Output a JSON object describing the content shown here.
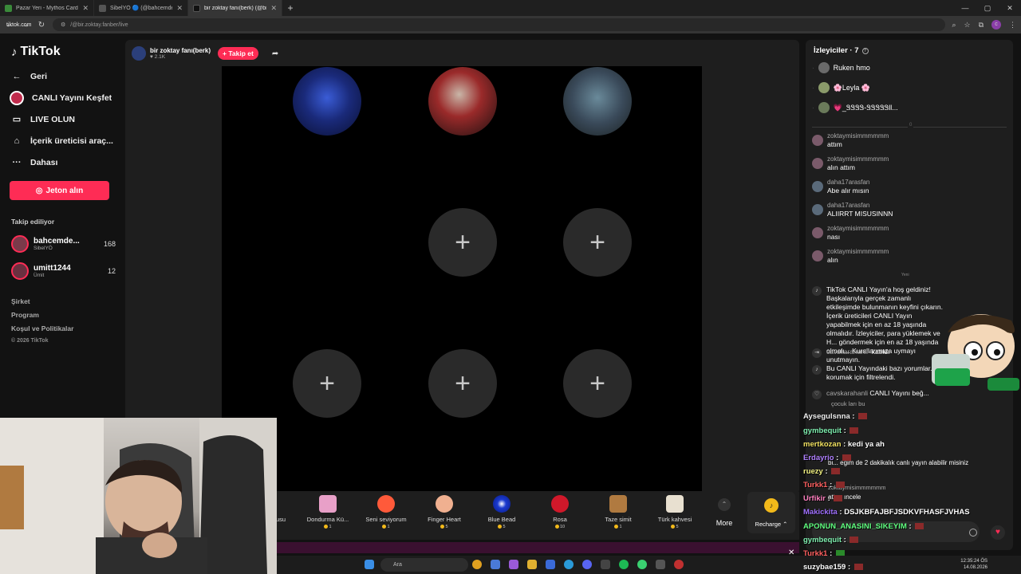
{
  "browser": {
    "tabs": [
      {
        "title": "Pazar Yeri - Mythos Cards",
        "color": "#3a8a3a",
        "active": false
      },
      {
        "title": "SibelYÖ 🔵 (@bahcemden...",
        "color": "#444444",
        "active": false
      },
      {
        "title": "bir zoktay fanı(berk) (@bir...",
        "color": "#444444",
        "active": true
      }
    ],
    "url_host": "tiktok.com",
    "url_path": "/@bir.zoktay.fanber/live"
  },
  "sidebar": {
    "logo": "TikTok",
    "items": [
      {
        "label": "Geri",
        "icon": "back-arrow-icon"
      },
      {
        "label": "CANLI Yayını Keşfet",
        "icon": "live-avatar-icon"
      },
      {
        "label": "LIVE OLUN",
        "icon": "camera-icon"
      },
      {
        "label": "İçerik üreticisi araç...",
        "icon": "home-icon"
      },
      {
        "label": "Dahası",
        "icon": "more-icon"
      }
    ],
    "jeton_button": "Jeton alın",
    "following_header": "Takip ediliyor",
    "following": [
      {
        "name": "bahcemde...",
        "sub": "SibelYÖ",
        "count": "168"
      },
      {
        "name": "umitt1244",
        "sub": "Ümit",
        "count": "12"
      }
    ],
    "footer": [
      "Şirket",
      "Program",
      "Koşul ve Politikalar"
    ],
    "copyright": "© 2026 TikTok"
  },
  "host": {
    "name": "bir zoktay fanı(berk)",
    "likes": "2.1K",
    "follow_button": "+ Takip et"
  },
  "gifts": [
    {
      "name": "usu",
      "price": ""
    },
    {
      "name": "Dondurma Kü...",
      "price": "1"
    },
    {
      "name": "Seni seviyorum",
      "price": "1"
    },
    {
      "name": "Finger Heart",
      "price": "5"
    },
    {
      "name": "Blue Bead",
      "price": "5"
    },
    {
      "name": "Rosa",
      "price": "10"
    },
    {
      "name": "Taze simit",
      "price": "1"
    },
    {
      "name": "Türk kahvesi",
      "price": "5"
    }
  ],
  "gift_more": "More",
  "recharge": "Recharge",
  "viewers": {
    "header": "İzleyiciler · 7",
    "list": [
      "Ruken hmo",
      "🌸Leyla 🌸",
      "💗_ᏕᏕᏕᏕ-ᏕᏕᏕᏕᏕll..."
    ],
    "divider_count": "0"
  },
  "chat": [
    {
      "user": "zoktaymisimmmmmm",
      "text": "attım"
    },
    {
      "user": "zoktaymisimmmmmm",
      "text": "alın attım"
    },
    {
      "user": "daha17arasfan",
      "text": "Abe alır mısın"
    },
    {
      "user": "daha17arasfan",
      "text": "ALIIRRT MISUSINNN"
    },
    {
      "user": "zoktaymisimmmmmm",
      "text": "nası"
    },
    {
      "user": "zoktaymisimmmmmm",
      "text": "alın"
    }
  ],
  "chat_new_label": "Yeni",
  "system": [
    {
      "text": "TikTok CANLI Yayın'a hoş geldiniz! Başkalarıyla gerçek zamanlı etkileşimde bulunmanın keyfini çıkarın. İçerik üreticileri CANLI Yayın yapabilmek için en az 18 yaşında olmalıdır. İzleyiciler, para yüklemek ve H... göndermek için en az 18 yaşında olmalı... Kurallarımıza uymayı unutmayın."
    },
    {
      "user": "cavskarahanli",
      "text": "katıldı"
    },
    {
      "text": "Bu CANLI Yayındaki bazı yorumlar... korumak için filtrelendi."
    },
    {
      "user": "cavskarahanli",
      "text": "CANLI Yayını beğ..."
    }
  ],
  "overlay_chat": [
    {
      "user": "Aysegulsnna",
      "color": "#f0f0f0",
      "msg": ""
    },
    {
      "user": "gymbequit",
      "color": "#7ff0b0",
      "msg": ""
    },
    {
      "user": "mertkozan",
      "color": "#f0e060",
      "msg": "kedi ya ah"
    },
    {
      "user": "Erdayrio",
      "color": "#b080ff",
      "msg": ""
    },
    {
      "user": "ruezy",
      "color": "#f0f080",
      "msg": ""
    },
    {
      "user": "Turkk1",
      "color": "#ff6060",
      "msg": ""
    },
    {
      "user": "Urfikir",
      "color": "#ff80c0",
      "msg": ""
    },
    {
      "user": "Makickita",
      "color": "#a070ff",
      "msg": "DSJKBFAJBFJSDKVFHASFJVHAS"
    },
    {
      "user": "APONUN_ANASINI_SIKEYIM",
      "color": "#60ff80",
      "msg": ""
    },
    {
      "user": "gymbequit",
      "color": "#7ff0b0",
      "msg": ""
    },
    {
      "user": "Turkk1",
      "color": "#ff6060",
      "msg": ""
    },
    {
      "user": "suzybae159",
      "color": "#ffffff",
      "msg": ""
    }
  ],
  "overlay_fragments": {
    "line1": "çocuk ları bu",
    "line2": "bi... eğim de 2 dakikalık canlı yayın alabilir misiniz",
    "line3": "zoktaymisimmmmmm",
    "line4": "attım ıncele"
  },
  "taskbar": {
    "search": "Ara",
    "time": "12:35:24 ÖS",
    "date": "14.08.2026"
  }
}
